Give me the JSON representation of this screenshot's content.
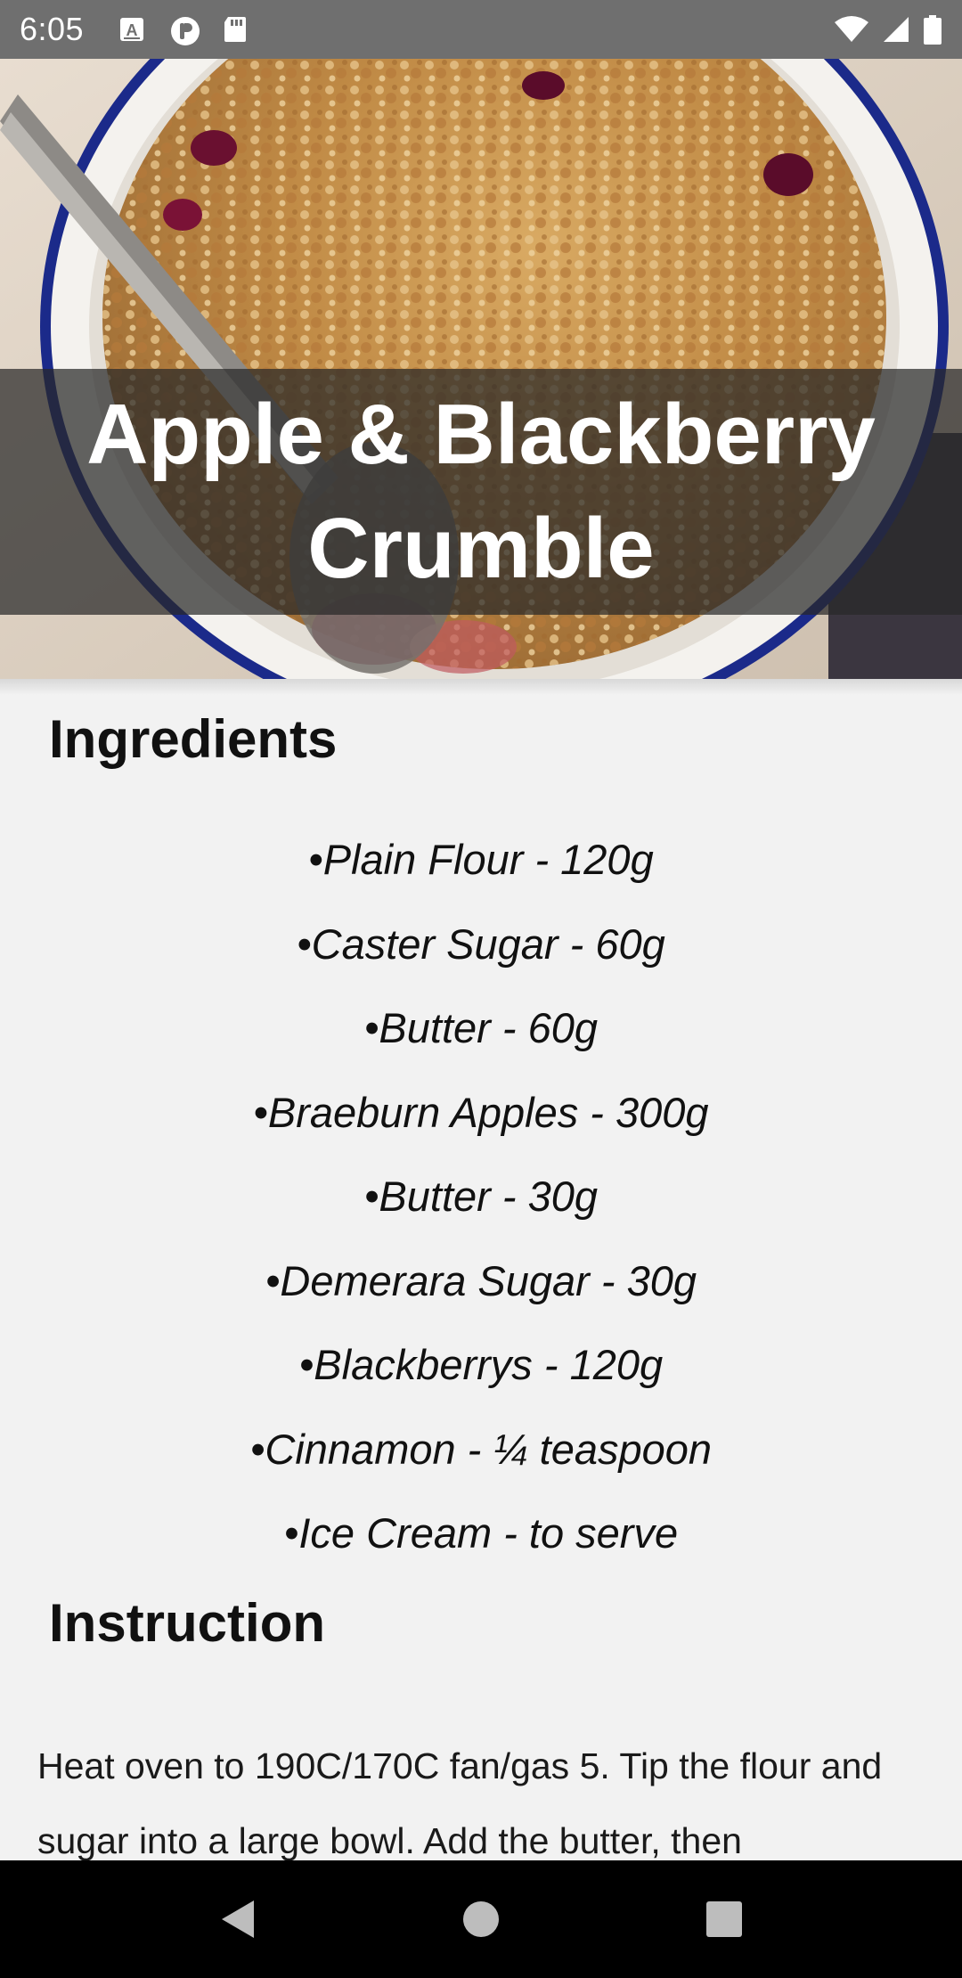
{
  "status_bar": {
    "time": "6:05",
    "left_icons": [
      "accessibility-a-icon",
      "pocket-app-icon",
      "sd-card-icon"
    ],
    "right_icons": [
      "wifi-icon",
      "cell-signal-icon",
      "battery-icon"
    ]
  },
  "hero": {
    "title": "Apple & Blackberry Crumble",
    "image": "crumble-dish-photo"
  },
  "ingredients": {
    "heading": "Ingredients",
    "items": [
      "•Plain Flour - 120g",
      "•Caster Sugar - 60g",
      "•Butter - 60g",
      "•Braeburn Apples - 300g",
      "•Butter - 30g",
      "•Demerara Sugar - 30g",
      "•Blackberrys - 120g",
      "•Cinnamon - ¼ teaspoon",
      "•Ice Cream - to serve"
    ]
  },
  "instruction": {
    "heading": "Instruction",
    "text": "Heat oven to 190C/170C fan/gas 5. Tip the flour and sugar into a large bowl. Add the butter, then"
  },
  "nav_bar": {
    "buttons": [
      "back-icon",
      "home-icon",
      "recents-icon"
    ]
  },
  "colors": {
    "status_bar": "#6f6f6f",
    "background": "#f2f2f2",
    "banner_overlay": "rgba(40,40,40,0.72)",
    "nav_bar": "#000000"
  }
}
